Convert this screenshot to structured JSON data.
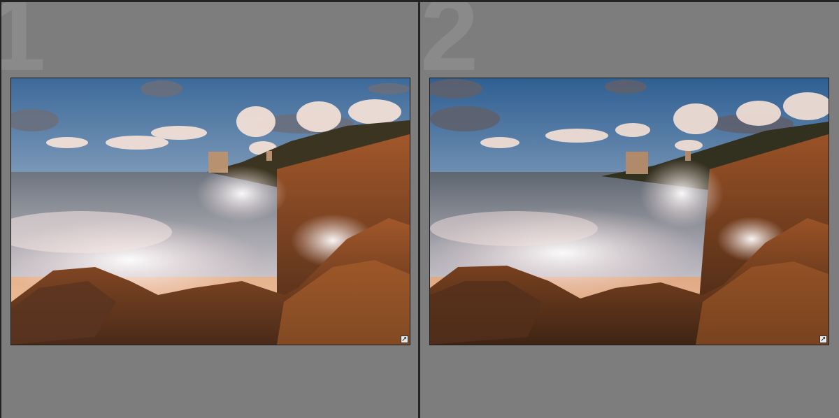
{
  "app": {
    "view_mode": "compare"
  },
  "panes": [
    {
      "number": "1",
      "photo": {
        "subject": "coastal-sunset-waves-photo",
        "edited_badge_icon": "develop-settings-icon"
      }
    },
    {
      "number": "2",
      "photo": {
        "subject": "coastal-sunset-waves-photo",
        "edited_badge_icon": "develop-settings-icon"
      }
    }
  ],
  "colors": {
    "pane_background": "#7d7d7d",
    "pane_number": "#8a8a8a",
    "divider": "#232323"
  }
}
